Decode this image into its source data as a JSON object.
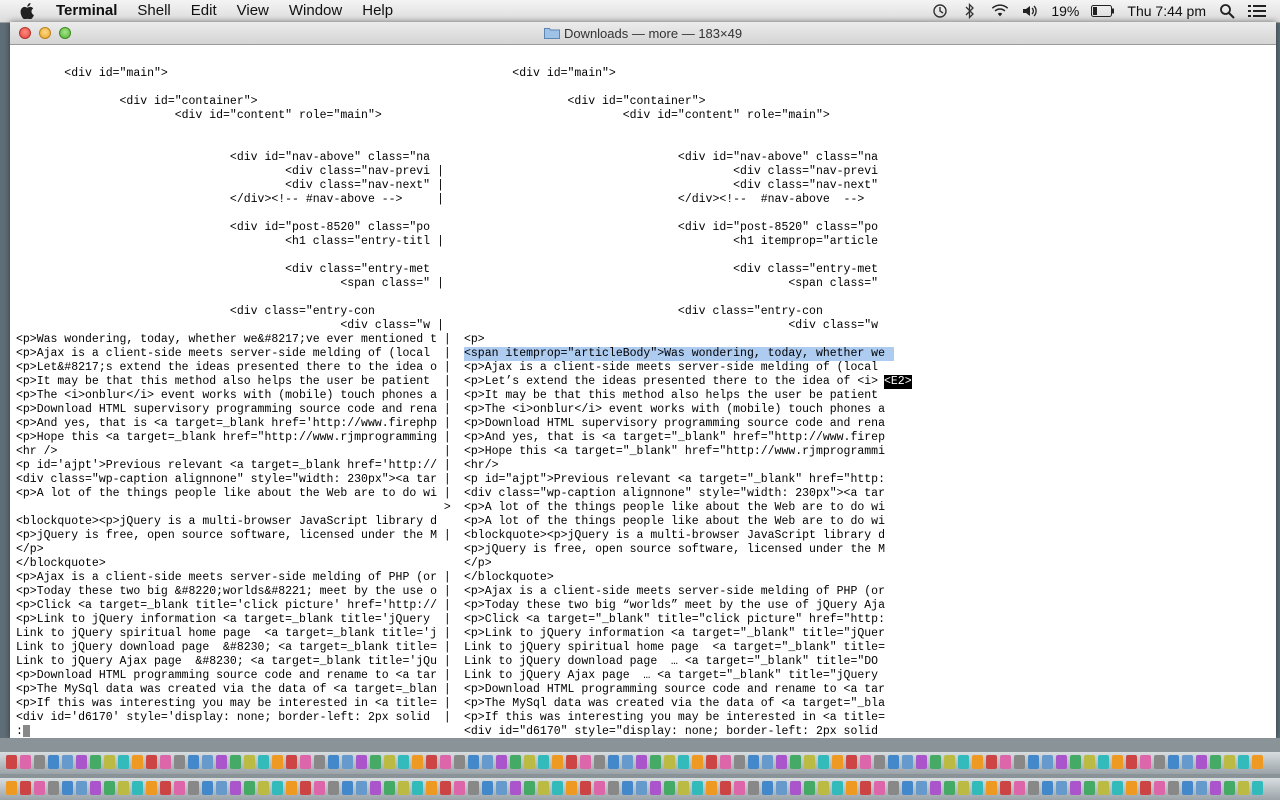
{
  "menubar": {
    "app": "Terminal",
    "items": [
      "Shell",
      "Edit",
      "View",
      "Window",
      "Help"
    ],
    "battery": "19%",
    "clock": "Thu 7:44 pm",
    "icons": [
      "apple-icon",
      "time-machine-icon",
      "bluetooth-icon",
      "wifi-icon",
      "volume-icon",
      "battery-icon",
      "spotlight-icon",
      "notification-center-icon"
    ]
  },
  "window": {
    "title": "Downloads — more — 183×49",
    "folder_icon": "folder-icon"
  },
  "terminal": {
    "left": [
      "       <div id=\"main\">",
      "",
      "               <div id=\"container\">",
      "                       <div id=\"content\" role=\"main\">",
      "",
      "",
      "                               <div id=\"nav-above\" class=\"na",
      "                                       <div class=\"nav-previ |",
      "                                       <div class=\"nav-next\" |",
      "                               </div><!-- #nav-above -->     |",
      "",
      "                               <div id=\"post-8520\" class=\"po",
      "                                       <h1 class=\"entry-titl |",
      "",
      "                                       <div class=\"entry-met",
      "                                               <span class=\" |",
      "",
      "                               <div class=\"entry-con",
      "                                               <div class=\"w |",
      "<p>Was wondering, today, whether we&#8217;ve ever mentioned t |",
      "<p>Ajax is a client-side meets server-side melding of (local  |",
      "<p>Let&#8217;s extend the ideas presented there to the idea o |",
      "<p>It may be that this method also helps the user be patient  |",
      "<p>The <i>onblur</i> event works with (mobile) touch phones a |",
      "<p>Download HTML supervisory programming source code and rena |",
      "<p>And yes, that is <a target=_blank href='http://www.firephp |",
      "<p>Hope this <a target=_blank href=\"http://www.rjmprogramming |",
      "<hr />                                                        |",
      "<p id='ajpt'>Previous relevant <a target=_blank href='http:// |",
      "<div class=\"wp-caption alignnone\" style=\"width: 230px\"><a tar |",
      "<p>A lot of the things people like about the Web are to do wi |",
      "                                                              >",
      "<blockquote><p>jQuery is a multi-browser JavaScript library d",
      "<p>jQuery is free, open source software, licensed under the M |",
      "</p>",
      "</blockquote>",
      "<p>Ajax is a client-side meets server-side melding of PHP (or |",
      "<p>Today these two big &#8220;worlds&#8221; meet by the use o |",
      "<p>Click <a target=_blank title='click picture' href='http:// |",
      "<p>Link to jQuery information <a target=_blank title='jQuery  |",
      "Link to jQuery spiritual home page  <a target=_blank title='j |",
      "Link to jQuery download page  &#8230; <a target=_blank title= |",
      "Link to jQuery Ajax page  &#8230; <a target=_blank title='jQu |",
      "<p>Download HTML programming source code and rename to <a tar |",
      "<p>The MySql data was created via the data of <a target=_blan |",
      "<p>If this was interesting you may be interested in <a title= |",
      "<div id='d6170' style='display: none; border-left: 2px solid  |"
    ],
    "right": [
      "       <div id=\"main\">",
      "",
      "               <div id=\"container\">",
      "                       <div id=\"content\" role=\"main\">",
      "",
      "",
      "                               <div id=\"nav-above\" class=\"na",
      "                                       <div class=\"nav-previ",
      "                                       <div class=\"nav-next\"",
      "                               </div><!--  #nav-above  -->",
      "",
      "                               <div id=\"post-8520\" class=\"po",
      "                                       <h1 itemprop=\"article",
      "",
      "                                       <div class=\"entry-met",
      "                                               <span class=\"",
      "",
      "                               <div class=\"entry-con",
      "                                               <div class=\"w",
      "<p>",
      "<span itemprop=\"articleBody\">Was wondering, today, whether we",
      "<p>Ajax is a client-side meets server-side melding of (local",
      "<p>Let’s extend the ideas presented there to the idea of <i>",
      "<p>It may be that this method also helps the user be patient",
      "<p>The <i>onblur</i> event works with (mobile) touch phones a",
      "<p>Download HTML supervisory programming source code and rena",
      "<p>And yes, that is <a target=\"_blank\" href=\"http://www.firep",
      "<p>Hope this <a target=\"_blank\" href=\"http://www.rjmprogrammi",
      "<hr/>",
      "<p id=\"ajpt\">Previous relevant <a target=\"_blank\" href=\"http:",
      "<div class=\"wp-caption alignnone\" style=\"width: 230px\"><a tar",
      "<p>A lot of the things people like about the Web are to do wi",
      "<p>A lot of the things people like about the Web are to do wi",
      "<blockquote><p>jQuery is a multi-browser JavaScript library d",
      "<p>jQuery is free, open source software, licensed under the M",
      "</p>",
      "</blockquote>",
      "<p>Ajax is a client-side meets server-side melding of PHP (or",
      "<p>Today these two big “worlds” meet by the use of jQuery Aja",
      "<p>Click <a target=\"_blank\" title=\"click picture\" href=\"http:",
      "<p>Link to jQuery information <a target=\"_blank\" title=\"jQuer",
      "Link to jQuery spiritual home page  <a target=\"_blank\" title=",
      "Link to jQuery download page  … <a target=\"_blank\" title=\"DO",
      "Link to jQuery Ajax page  … <a target=\"_blank\" title=\"jQuery",
      "<p>Download HTML programming source code and rename to <a tar",
      "<p>The MySql data was created via the data of <a target=\"_bla",
      "<p>If this was interesting you may be interested in <a title=",
      "<div id=\"d6170\" style=\"display: none; border-left: 2px solid"
    ],
    "e2_marker": "<E2>",
    "prompt": ":"
  },
  "colors": {
    "selection": "#aecbf0",
    "desktop": "#5f6e78"
  }
}
